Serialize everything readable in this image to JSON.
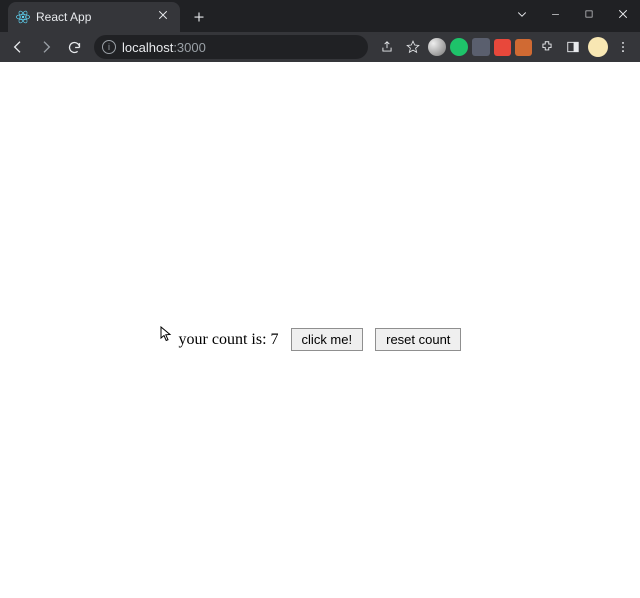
{
  "browser": {
    "tab": {
      "title": "React App"
    },
    "url": {
      "host": "localhost",
      "port": ":3000"
    }
  },
  "app": {
    "count_label_prefix": "your count is: ",
    "count_value": "7",
    "click_button_label": "click me!",
    "reset_button_label": "reset count"
  }
}
